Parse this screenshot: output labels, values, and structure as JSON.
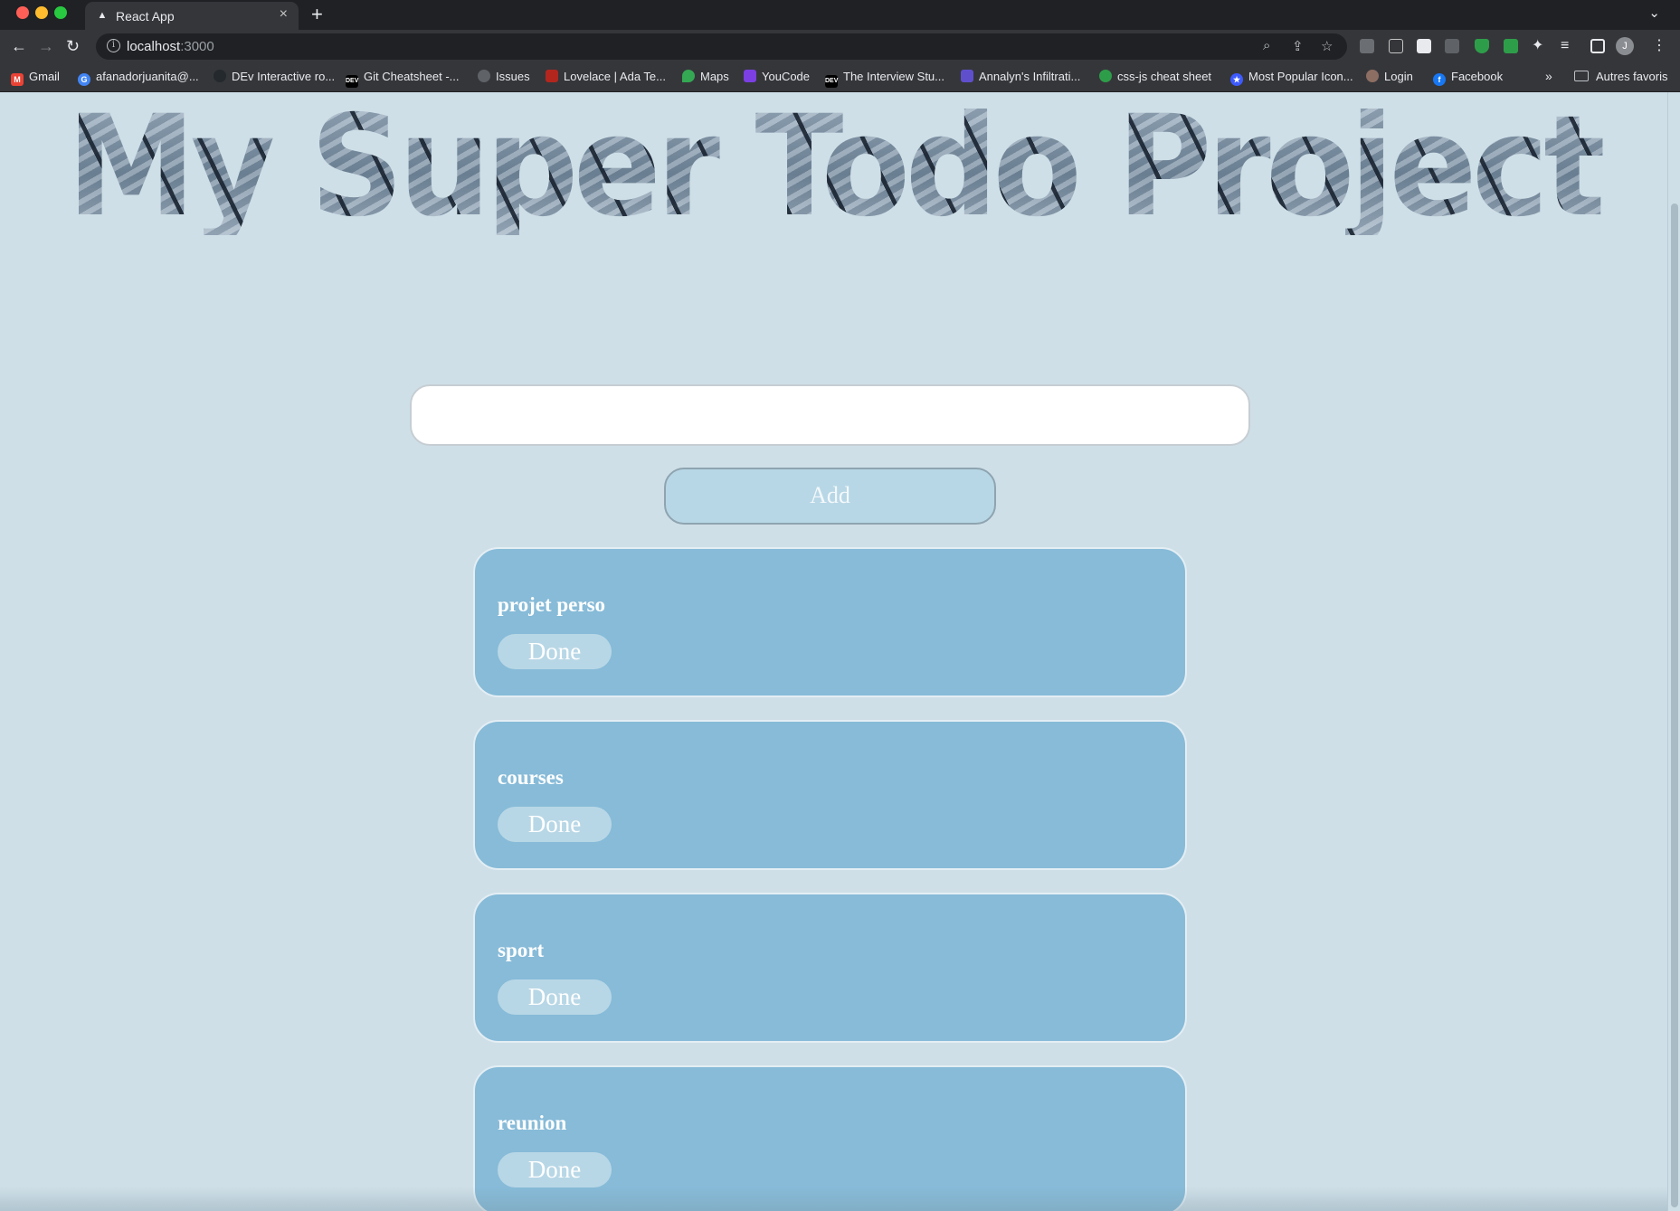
{
  "browser": {
    "tab_title": "React App",
    "url_host": "localhost",
    "url_port": ":3000",
    "bookmarks": [
      {
        "label": "Gmail",
        "icon": "gmail-icon",
        "color": "#ea4335"
      },
      {
        "label": "afanadorjuanita@...",
        "icon": "google-icon",
        "color": "#4285f4"
      },
      {
        "label": "DEv Interactive ro...",
        "icon": "github-icon",
        "color": "#24292e"
      },
      {
        "label": "Git Cheatsheet -...",
        "icon": "dev-icon",
        "color": "#000000"
      },
      {
        "label": "Issues",
        "icon": "globe-icon",
        "color": "#5f6368"
      },
      {
        "label": "Lovelace | Ada Te...",
        "icon": "ada-icon",
        "color": "#b3261e"
      },
      {
        "label": "Maps",
        "icon": "maps-icon",
        "color": "#34a853"
      },
      {
        "label": "YouCode",
        "icon": "youcode-icon",
        "color": "#7b3fe4"
      },
      {
        "label": "The Interview Stu...",
        "icon": "dev-icon",
        "color": "#000000"
      },
      {
        "label": "Annalyn's Infiltrati...",
        "icon": "exercism-icon",
        "color": "#604fcd"
      },
      {
        "label": "css-js cheat sheet",
        "icon": "leaf-icon",
        "color": "#2e9d4a"
      },
      {
        "label": "Most Popular Icon...",
        "icon": "star-icon",
        "color": "#3d5afe"
      },
      {
        "label": "Login",
        "icon": "mascot-icon",
        "color": "#8d6e63"
      },
      {
        "label": "Facebook",
        "icon": "facebook-icon",
        "color": "#1877f2"
      }
    ],
    "other_bookmarks": "Autres favoris"
  },
  "page": {
    "heading": "My Super Todo Project",
    "input_value": "",
    "add_label": "Add",
    "todos": [
      {
        "title": "projet perso",
        "done_label": "Done"
      },
      {
        "title": "courses",
        "done_label": "Done"
      },
      {
        "title": "sport",
        "done_label": "Done"
      },
      {
        "title": "reunion",
        "done_label": "Done"
      }
    ]
  }
}
